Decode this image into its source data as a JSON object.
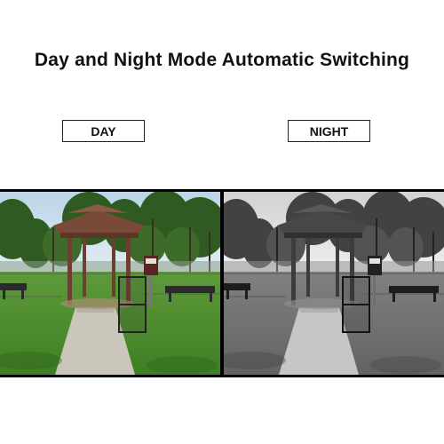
{
  "title": "Day and Night Mode Automatic Switching",
  "labels": {
    "day": "DAY",
    "night": "NIGHT"
  }
}
